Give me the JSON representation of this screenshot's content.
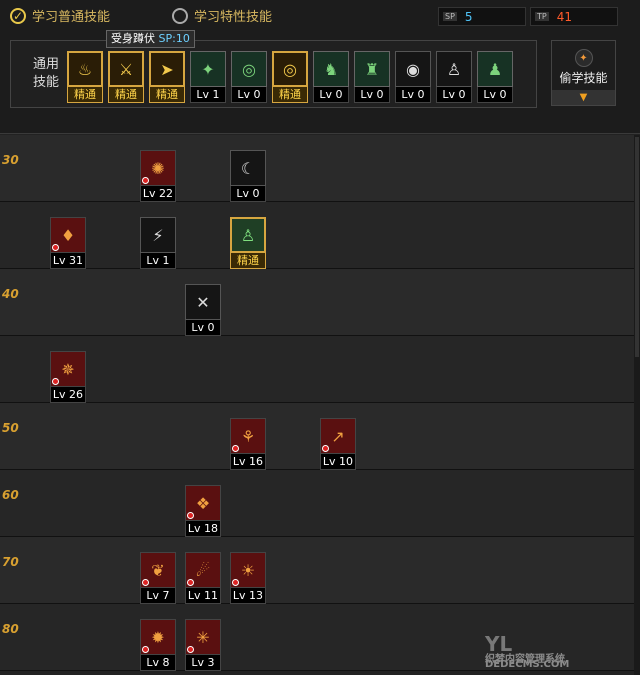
{
  "tabs": [
    {
      "label": "学习普通技能",
      "selected": true
    },
    {
      "label": "学习特性技能",
      "selected": false
    }
  ],
  "points": [
    {
      "tag": "SP",
      "value": "5",
      "color": "#4fc3f7"
    },
    {
      "tag": "TP",
      "value": "41",
      "color": "#ff5a2a"
    }
  ],
  "common": {
    "label": "通用技能",
    "tooltip": {
      "name": "受身蹲伏",
      "sp": "SP:10"
    },
    "slots": [
      {
        "icon": "crouch-icon",
        "glyph": "♨",
        "level": "精通",
        "style": "gold"
      },
      {
        "icon": "roll-icon",
        "glyph": "⚔",
        "level": "精通",
        "style": "gold"
      },
      {
        "icon": "run-icon",
        "glyph": "➤",
        "level": "精通",
        "style": "gold"
      },
      {
        "icon": "wings-icon",
        "glyph": "✦",
        "level": "Lv 1",
        "style": "green"
      },
      {
        "icon": "target-icon",
        "glyph": "◎",
        "level": "Lv 0",
        "style": "green"
      },
      {
        "icon": "target-gold-icon",
        "glyph": "◎",
        "level": "精通",
        "style": "gold"
      },
      {
        "icon": "knight-icon",
        "glyph": "♞",
        "level": "Lv 0",
        "style": "green"
      },
      {
        "icon": "wizard-icon",
        "glyph": "♜",
        "level": "Lv 0",
        "style": "green"
      },
      {
        "icon": "eye-icon",
        "glyph": "◉",
        "level": "Lv 0",
        "style": "plain"
      },
      {
        "icon": "muscle-icon",
        "glyph": "♙",
        "level": "Lv 0",
        "style": "plain"
      },
      {
        "icon": "figure-icon",
        "glyph": "♟",
        "level": "Lv 0",
        "style": "green"
      }
    ]
  },
  "steal": {
    "label": "偷学技能",
    "icon": "steal-icon",
    "arrow": "▼"
  },
  "rows": [
    {
      "label": "30",
      "skills": [
        {
          "icon": "skill-burst-icon",
          "glyph": "✺",
          "level": "Lv 22",
          "style": "red",
          "col": 1
        },
        {
          "icon": "skill-slash-icon",
          "glyph": "☾",
          "level": "Lv 0",
          "style": "plain",
          "col": 3
        }
      ]
    },
    {
      "label": "",
      "skills": [
        {
          "icon": "skill-flame-icon",
          "glyph": "♦",
          "level": "Lv 31",
          "style": "red",
          "col": 0
        },
        {
          "icon": "skill-claw-icon",
          "glyph": "⚡",
          "level": "Lv 1",
          "style": "plain",
          "col": 1
        },
        {
          "icon": "skill-aura-icon",
          "glyph": "♙",
          "level": "精通",
          "style": "gold-green",
          "col": 3
        }
      ]
    },
    {
      "label": "40",
      "skills": [
        {
          "icon": "skill-cross-icon",
          "glyph": "✕",
          "level": "Lv 0",
          "style": "plain",
          "col": 2
        }
      ]
    },
    {
      "label": "",
      "skills": [
        {
          "icon": "skill-vortex-icon",
          "glyph": "✵",
          "level": "Lv 26",
          "style": "red",
          "col": 0
        }
      ]
    },
    {
      "label": "50",
      "skills": [
        {
          "icon": "skill-fang-icon",
          "glyph": "⚘",
          "level": "Lv 16",
          "style": "red",
          "col": 3
        },
        {
          "icon": "skill-spear-icon",
          "glyph": "↗",
          "level": "Lv 10",
          "style": "red",
          "col": 5
        }
      ]
    },
    {
      "label": "60",
      "skills": [
        {
          "icon": "skill-wing-icon",
          "glyph": "❖",
          "level": "Lv 18",
          "style": "red",
          "col": 2
        }
      ]
    },
    {
      "label": "70",
      "skills": [
        {
          "icon": "skill-leaf-icon",
          "glyph": "❦",
          "level": "Lv 7",
          "style": "red",
          "col": 1
        },
        {
          "icon": "skill-beam-icon",
          "glyph": "☄",
          "level": "Lv 11",
          "style": "red",
          "col": 2
        },
        {
          "icon": "skill-orb-icon",
          "glyph": "☀",
          "level": "Lv 13",
          "style": "red",
          "col": 3
        }
      ]
    },
    {
      "label": "80",
      "skills": [
        {
          "icon": "skill-sun-icon",
          "glyph": "✹",
          "level": "Lv 8",
          "style": "red",
          "col": 1
        },
        {
          "icon": "skill-web-icon",
          "glyph": "✳",
          "level": "Lv 3",
          "style": "red",
          "col": 2
        }
      ]
    }
  ],
  "watermark": {
    "text": "YL",
    "sub": "织梦内容管理系统",
    "url": "DEDECMS.COM"
  }
}
